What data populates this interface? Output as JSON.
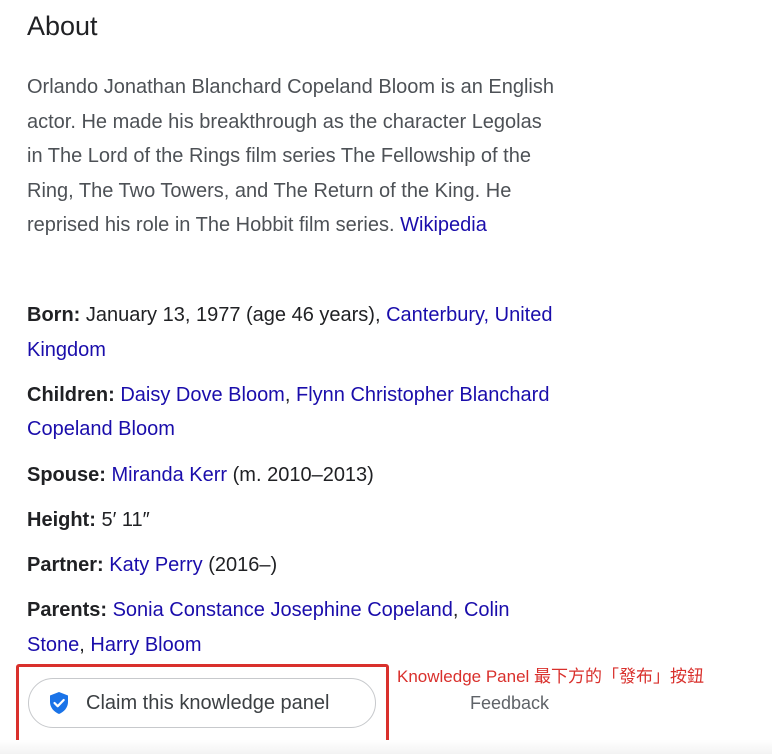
{
  "about": {
    "heading": "About",
    "description": "Orlando Jonathan Blanchard Copeland Bloom is an English actor. He made his breakthrough as the character Legolas in The Lord of the Rings film series The Fellowship of the Ring, The Two Towers, and The Return of the King. He reprised his role in The Hobbit film series.",
    "source_link": "Wikipedia"
  },
  "facts": {
    "born": {
      "label": "Born:",
      "text": "January 13, 1977 (age 46 years),",
      "place_link": "Canterbury, United Kingdom"
    },
    "children": {
      "label": "Children:",
      "child1": "Daisy Dove Bloom",
      "separator": ",",
      "child2": "Flynn Christopher Blanchard Copeland Bloom"
    },
    "spouse": {
      "label": "Spouse:",
      "name_link": "Miranda Kerr",
      "years": "(m. 2010–2013)"
    },
    "height": {
      "label": "Height:",
      "value": "5′ 11″"
    },
    "partner": {
      "label": "Partner:",
      "name_link": "Katy Perry",
      "years": "(2016–)"
    },
    "parents": {
      "label": "Parents:",
      "parent1": "Sonia Constance Josephine Copeland",
      "sep1": ",",
      "parent2": "Colin Stone",
      "sep2": ",",
      "parent3": "Harry Bloom"
    }
  },
  "actions": {
    "claim_label": "Claim this knowledge panel",
    "claim_icon": "shield-check-icon",
    "feedback_label": "Feedback"
  },
  "annotation": {
    "text": "Knowledge Panel 最下方的「發布」按鈕",
    "color": "#d9302c"
  },
  "colors": {
    "link": "#1a0dab",
    "text": "#202124",
    "muted_text": "#4d5156",
    "shield": "#1a73e8"
  }
}
